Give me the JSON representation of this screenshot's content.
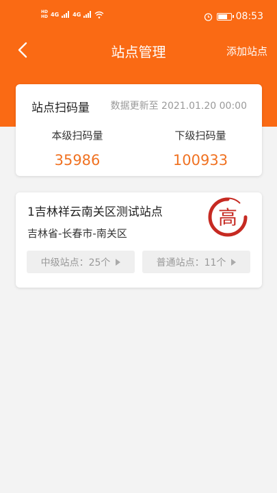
{
  "status_bar": {
    "hd1": "HD",
    "hd2": "HD",
    "signal1": "4G",
    "signal2": "4G",
    "time": "08:53",
    "battery_level": 0.8
  },
  "nav": {
    "title": "站点管理",
    "action_label": "添加站点"
  },
  "colors": {
    "header": "#fa6a14",
    "accent_value": "#f07222",
    "logo_red": "#c62a22"
  },
  "summary": {
    "title": "站点扫码量",
    "update_text": "数据更新至 2021.01.20 00:00",
    "stats": [
      {
        "label": "本级扫码量",
        "value": "35986"
      },
      {
        "label": "下级扫码量",
        "value": "100933"
      }
    ]
  },
  "site": {
    "name": "1吉林祥云南关区测试站点",
    "address": "吉林省-长春市-南关区",
    "logo_char": "高",
    "mid_level_label": "中级站点：25个",
    "normal_label": "普通站点：11个"
  }
}
